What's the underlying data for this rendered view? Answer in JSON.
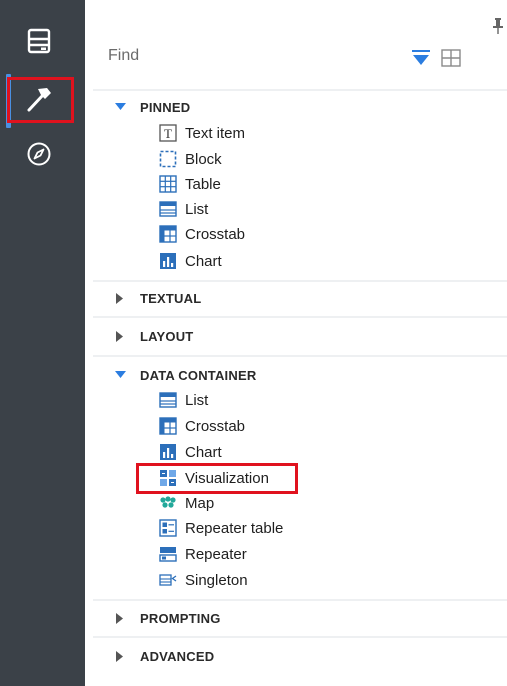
{
  "find": {
    "label": "Find"
  },
  "sections": [
    {
      "label": "PINNED",
      "expanded": true,
      "items": [
        {
          "label": "Text item",
          "icon": "text-item-icon"
        },
        {
          "label": "Block",
          "icon": "block-icon"
        },
        {
          "label": "Table",
          "icon": "table-icon"
        },
        {
          "label": "List",
          "icon": "list-icon"
        },
        {
          "label": "Crosstab",
          "icon": "crosstab-icon"
        },
        {
          "label": "Chart",
          "icon": "chart-icon"
        }
      ]
    },
    {
      "label": "TEXTUAL",
      "expanded": false
    },
    {
      "label": "LAYOUT",
      "expanded": false
    },
    {
      "label": "DATA CONTAINER",
      "expanded": true,
      "items": [
        {
          "label": "List",
          "icon": "list-icon"
        },
        {
          "label": "Crosstab",
          "icon": "crosstab-icon"
        },
        {
          "label": "Chart",
          "icon": "chart-icon"
        },
        {
          "label": "Visualization",
          "icon": "visualization-icon"
        },
        {
          "label": "Map",
          "icon": "map-icon"
        },
        {
          "label": "Repeater table",
          "icon": "repeater-table-icon"
        },
        {
          "label": "Repeater",
          "icon": "repeater-icon"
        },
        {
          "label": "Singleton",
          "icon": "singleton-icon"
        }
      ]
    },
    {
      "label": "PROMPTING",
      "expanded": false
    },
    {
      "label": "ADVANCED",
      "expanded": false
    }
  ],
  "colors": {
    "rail": "#3b4148",
    "accent": "#4a90e2",
    "highlight": "#e0121e",
    "icon_blue": "#2c6fba"
  }
}
